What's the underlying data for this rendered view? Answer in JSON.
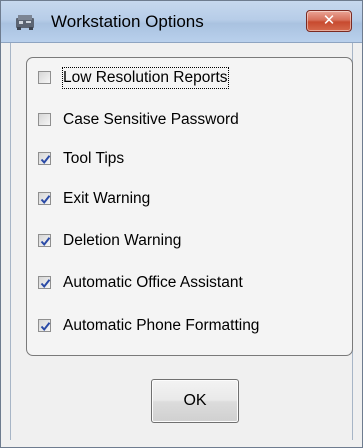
{
  "window": {
    "title": "Workstation Options",
    "close_label": "✕",
    "icon": "workstation-app-icon"
  },
  "options": [
    {
      "label": "Low Resolution Reports",
      "checked": false,
      "focused": true
    },
    {
      "label": "Case Sensitive Password",
      "checked": false,
      "focused": false
    },
    {
      "label": "Tool Tips",
      "checked": true,
      "focused": false
    },
    {
      "label": "Exit Warning",
      "checked": true,
      "focused": false
    },
    {
      "label": "Deletion Warning",
      "checked": true,
      "focused": false
    },
    {
      "label": "Automatic Office Assistant",
      "checked": true,
      "focused": false
    },
    {
      "label": "Automatic Phone Formatting",
      "checked": true,
      "focused": false
    }
  ],
  "buttons": {
    "ok_label": "OK"
  },
  "colors": {
    "check_mark": "#2a4aa6",
    "close_button": "#c74a2f",
    "titlebar": "#b7cde8"
  }
}
